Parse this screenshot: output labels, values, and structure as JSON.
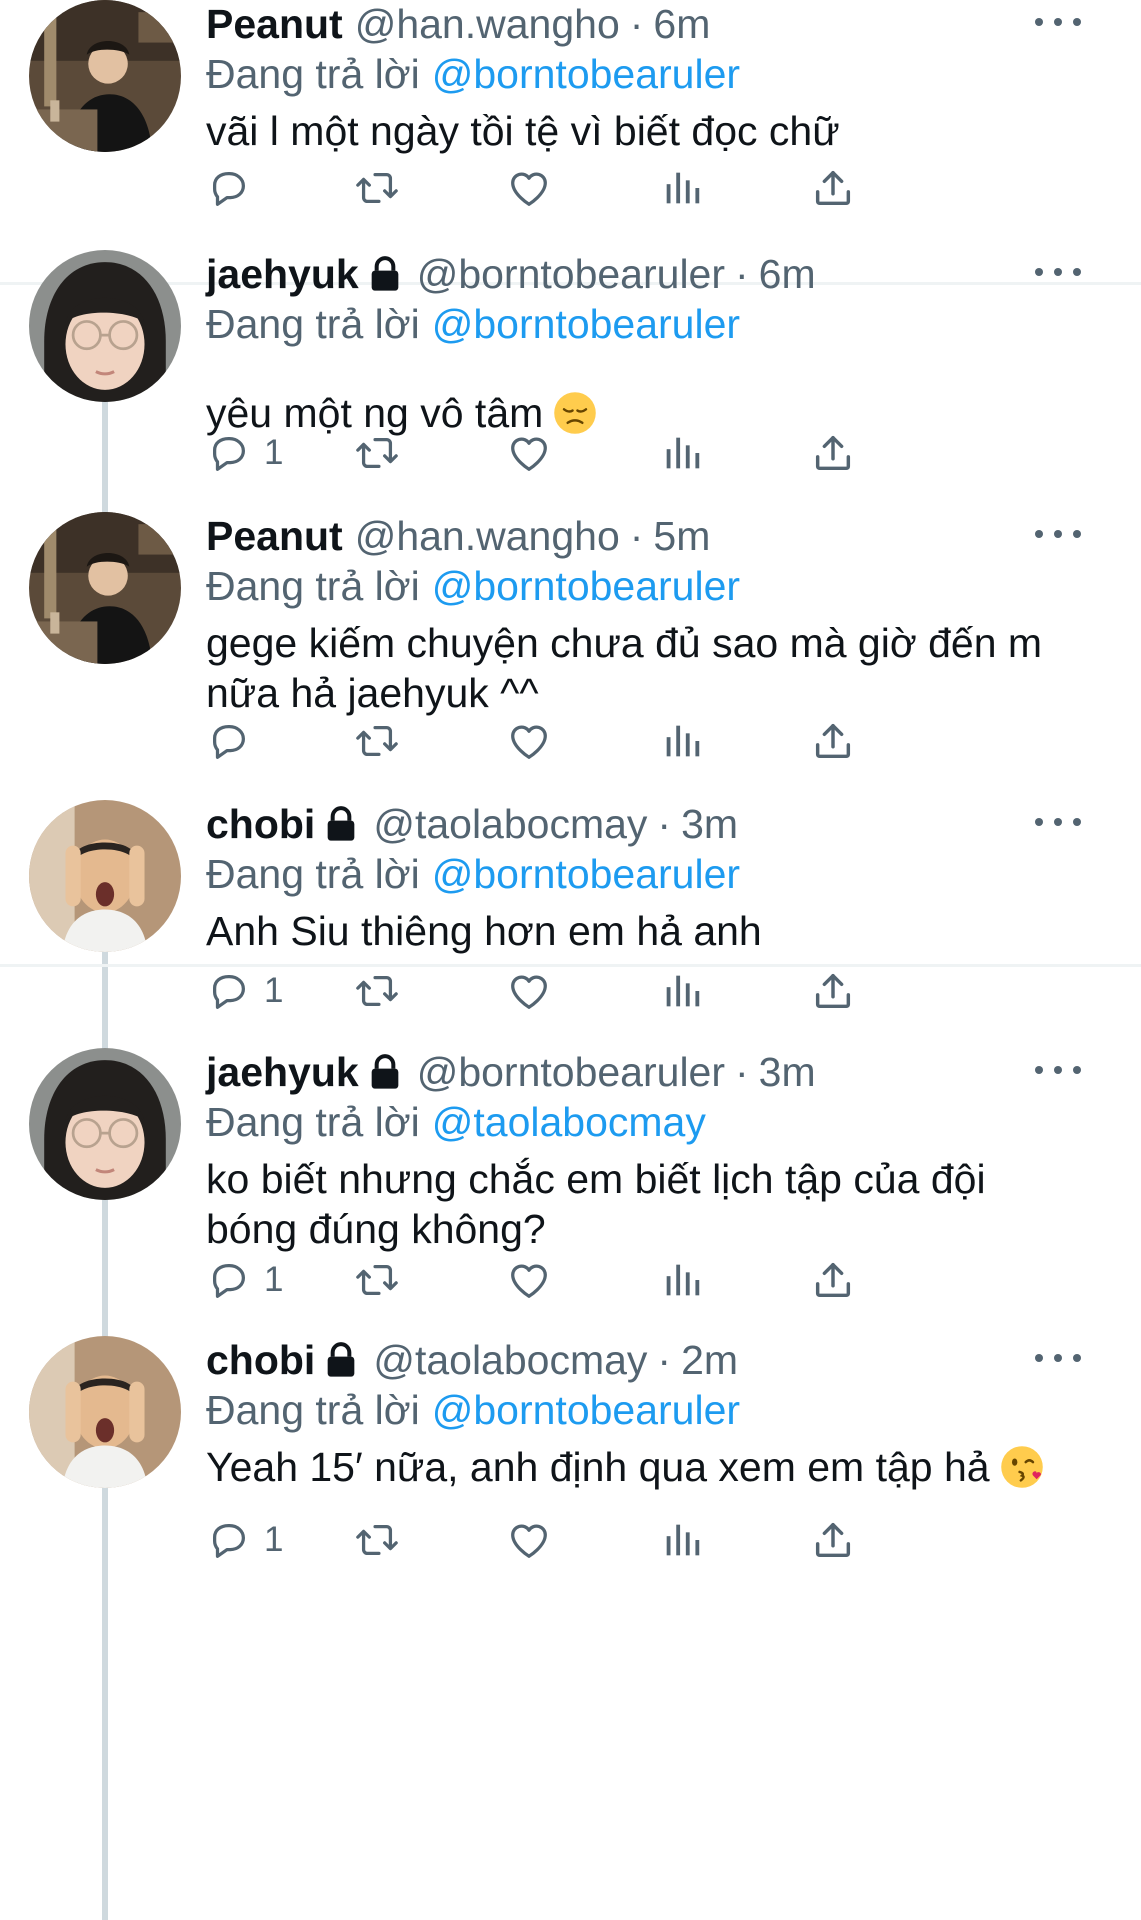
{
  "tweets": [
    {
      "name": "Peanut",
      "handle": "@han.wangho",
      "separator": "·",
      "time": "6m",
      "reply_label": "Đang trả lời",
      "reply_to": "@borntobearuler",
      "text": "vãi l một ngày tồi tệ vì biết đọc chữ",
      "text_line2": "",
      "reply_count": "",
      "avatar": "avatar-peanut",
      "protected": false
    },
    {
      "name": "jaehyuk",
      "handle": "@borntobearuler",
      "separator": "·",
      "time": "6m",
      "reply_label": "Đang trả lời",
      "reply_to": "@borntobearuler",
      "text": "yêu một ng vô tâm",
      "text_line2": "",
      "emoji": "pensive-face-emoji",
      "reply_count": "1",
      "avatar": "avatar-jaehyuk",
      "protected": true
    },
    {
      "name": "Peanut",
      "handle": "@han.wangho",
      "separator": "·",
      "time": "5m",
      "reply_label": "Đang trả lời",
      "reply_to": "@borntobearuler",
      "text": "gege kiếm chuyện chưa đủ sao mà giờ đến m",
      "text_line2": "nữa hả jaehyuk ^^",
      "reply_count": "",
      "avatar": "avatar-peanut",
      "protected": false
    },
    {
      "name": "chobi",
      "handle": "@taolabocmay",
      "separator": "·",
      "time": "3m",
      "reply_label": "Đang trả lời",
      "reply_to": "@borntobearuler",
      "text": "Anh Siu thiêng hơn em hả anh",
      "text_line2": "",
      "reply_count": "1",
      "avatar": "avatar-chobi",
      "protected": true
    },
    {
      "name": "jaehyuk",
      "handle": "@borntobearuler",
      "separator": "·",
      "time": "3m",
      "reply_label": "Đang trả lời",
      "reply_to": "@taolabocmay",
      "text": "ko biết nhưng chắc em biết lịch tập của đội",
      "text_line2": "bóng đúng không?",
      "reply_count": "1",
      "avatar": "avatar-jaehyuk",
      "protected": true
    },
    {
      "name": "chobi",
      "handle": "@taolabocmay",
      "separator": "·",
      "time": "2m",
      "reply_label": "Đang trả lời",
      "reply_to": "@borntobearuler",
      "text": "Yeah 15′ nữa, anh định qua xem em tập hả",
      "text_line2": "",
      "emoji": "kissing-face-emoji",
      "reply_count": "1",
      "avatar": "avatar-chobi",
      "protected": true
    }
  ],
  "icons": {
    "reply": "reply-icon",
    "retweet": "retweet-icon",
    "like": "heart-icon",
    "views": "views-icon",
    "share": "share-icon",
    "more": "more-icon",
    "lock": "lock-icon"
  },
  "colors": {
    "link": "#1d9bf0",
    "secondary_text": "#536471",
    "primary_text": "#0f1419",
    "thread_line": "#cfd9de",
    "divider": "#eff3f4"
  }
}
